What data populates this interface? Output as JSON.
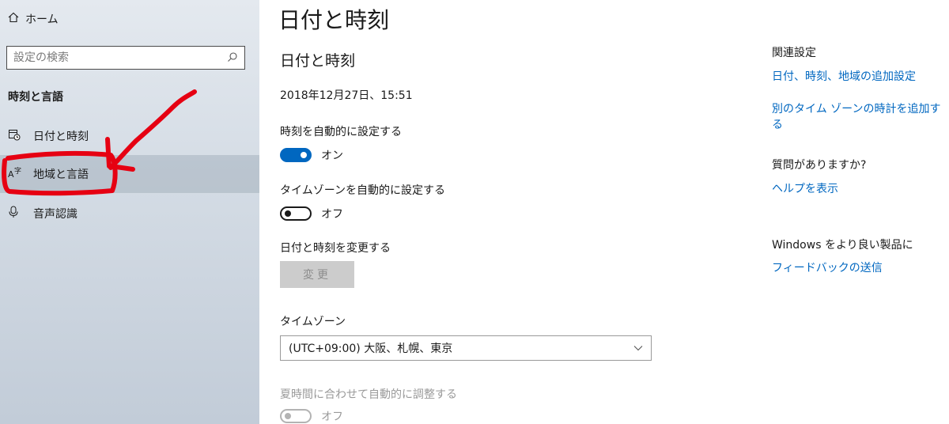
{
  "sidebar": {
    "home_label": "ホーム",
    "search_placeholder": "設定の検索",
    "section_heading": "時刻と言語",
    "items": [
      {
        "label": "日付と時刻",
        "icon": "calendar-clock-icon"
      },
      {
        "label": "地域と言語",
        "icon": "language-icon",
        "selected": true
      },
      {
        "label": "音声認識",
        "icon": "microphone-icon"
      }
    ]
  },
  "main": {
    "page_title": "日付と時刻",
    "section_title": "日付と時刻",
    "current_datetime": "2018年12月27日、15:51",
    "auto_time": {
      "label": "時刻を自動的に設定する",
      "state": "オン"
    },
    "auto_timezone": {
      "label": "タイムゾーンを自動的に設定する",
      "state": "オフ"
    },
    "change_datetime": {
      "label": "日付と時刻を変更する",
      "button": "変更"
    },
    "timezone": {
      "label": "タイムゾーン",
      "value": "(UTC+09:00) 大阪、札幌、東京"
    },
    "dst": {
      "label": "夏時間に合わせて自動的に調整する",
      "state": "オフ"
    }
  },
  "related": {
    "heading": "関連設定",
    "link1": "日付、時刻、地域の追加設定",
    "link2": "別のタイム ゾーンの時計を追加する",
    "question_heading": "質問がありますか?",
    "help_link": "ヘルプを表示",
    "feedback_heading": "Windows をより良い製品に",
    "feedback_link": "フィードバックの送信"
  },
  "colors": {
    "accent": "#0067c0",
    "annotation": "#e60012"
  }
}
